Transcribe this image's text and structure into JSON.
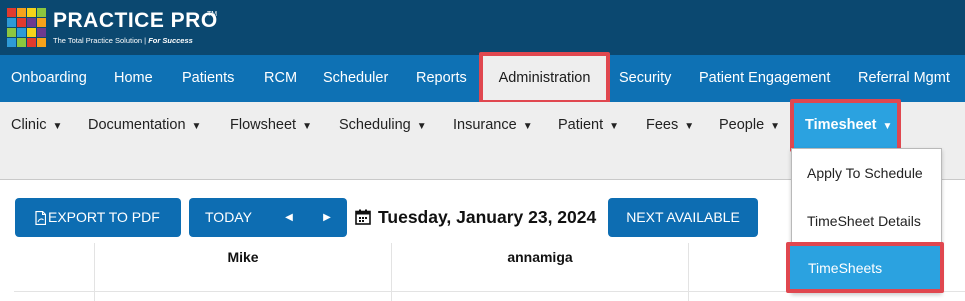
{
  "brand": {
    "name": "Practice Pro",
    "trademark": "TM",
    "tagline_main": "The Total Practice Solution | ",
    "tagline_emph": "For Success",
    "logo_colors": [
      "#e23a2e",
      "#f6a21b",
      "#f6d31a",
      "#8cc63f",
      "#2e9ad6",
      "#e23a2e",
      "#6d3a8f",
      "#f6a21b",
      "#8cc63f",
      "#2e9ad6",
      "#f6d31a",
      "#6d3a8f",
      "#2e9ad6",
      "#8cc63f",
      "#e23a2e",
      "#f6a21b"
    ]
  },
  "main_nav": {
    "items": [
      "Onboarding",
      "Home",
      "Patients",
      "RCM",
      "Scheduler",
      "Reports",
      "Administration",
      "Security",
      "Patient Engagement",
      "Referral Mgmt"
    ],
    "active": "Administration"
  },
  "sub_nav": {
    "items": [
      "Clinic",
      "Documentation",
      "Flowsheet",
      "Scheduling",
      "Insurance",
      "Patient",
      "Fees",
      "People",
      "Timesheet"
    ],
    "caret": "▼",
    "active": "Timesheet"
  },
  "dropdown": {
    "items": [
      "Apply To Schedule",
      "TimeSheet Details",
      "TimeSheets"
    ],
    "selected": "TimeSheets"
  },
  "toolbar": {
    "export_label": "EXPORT TO PDF",
    "today_label": "TODAY",
    "prev_arrow": "◀",
    "next_arrow": "▶",
    "date": "Tuesday, January 23, 2024",
    "next_available_label": "NEXT AVAILABLE"
  },
  "schedule": {
    "columns": [
      "Mike",
      "annamiga"
    ]
  },
  "colors": {
    "header_bg": "#0b4870",
    "nav_bg": "#0e71b4",
    "subnav_bg": "#eeeeee",
    "active_blue": "#2ba2e0",
    "highlight_red": "#e0474f",
    "button_blue": "#0d6db2"
  },
  "icons": {
    "export": "pdf-file-icon",
    "date": "calendar-icon",
    "prev": "triangle-left-icon",
    "next": "triangle-right-icon",
    "dropdown": "caret-down-icon"
  }
}
